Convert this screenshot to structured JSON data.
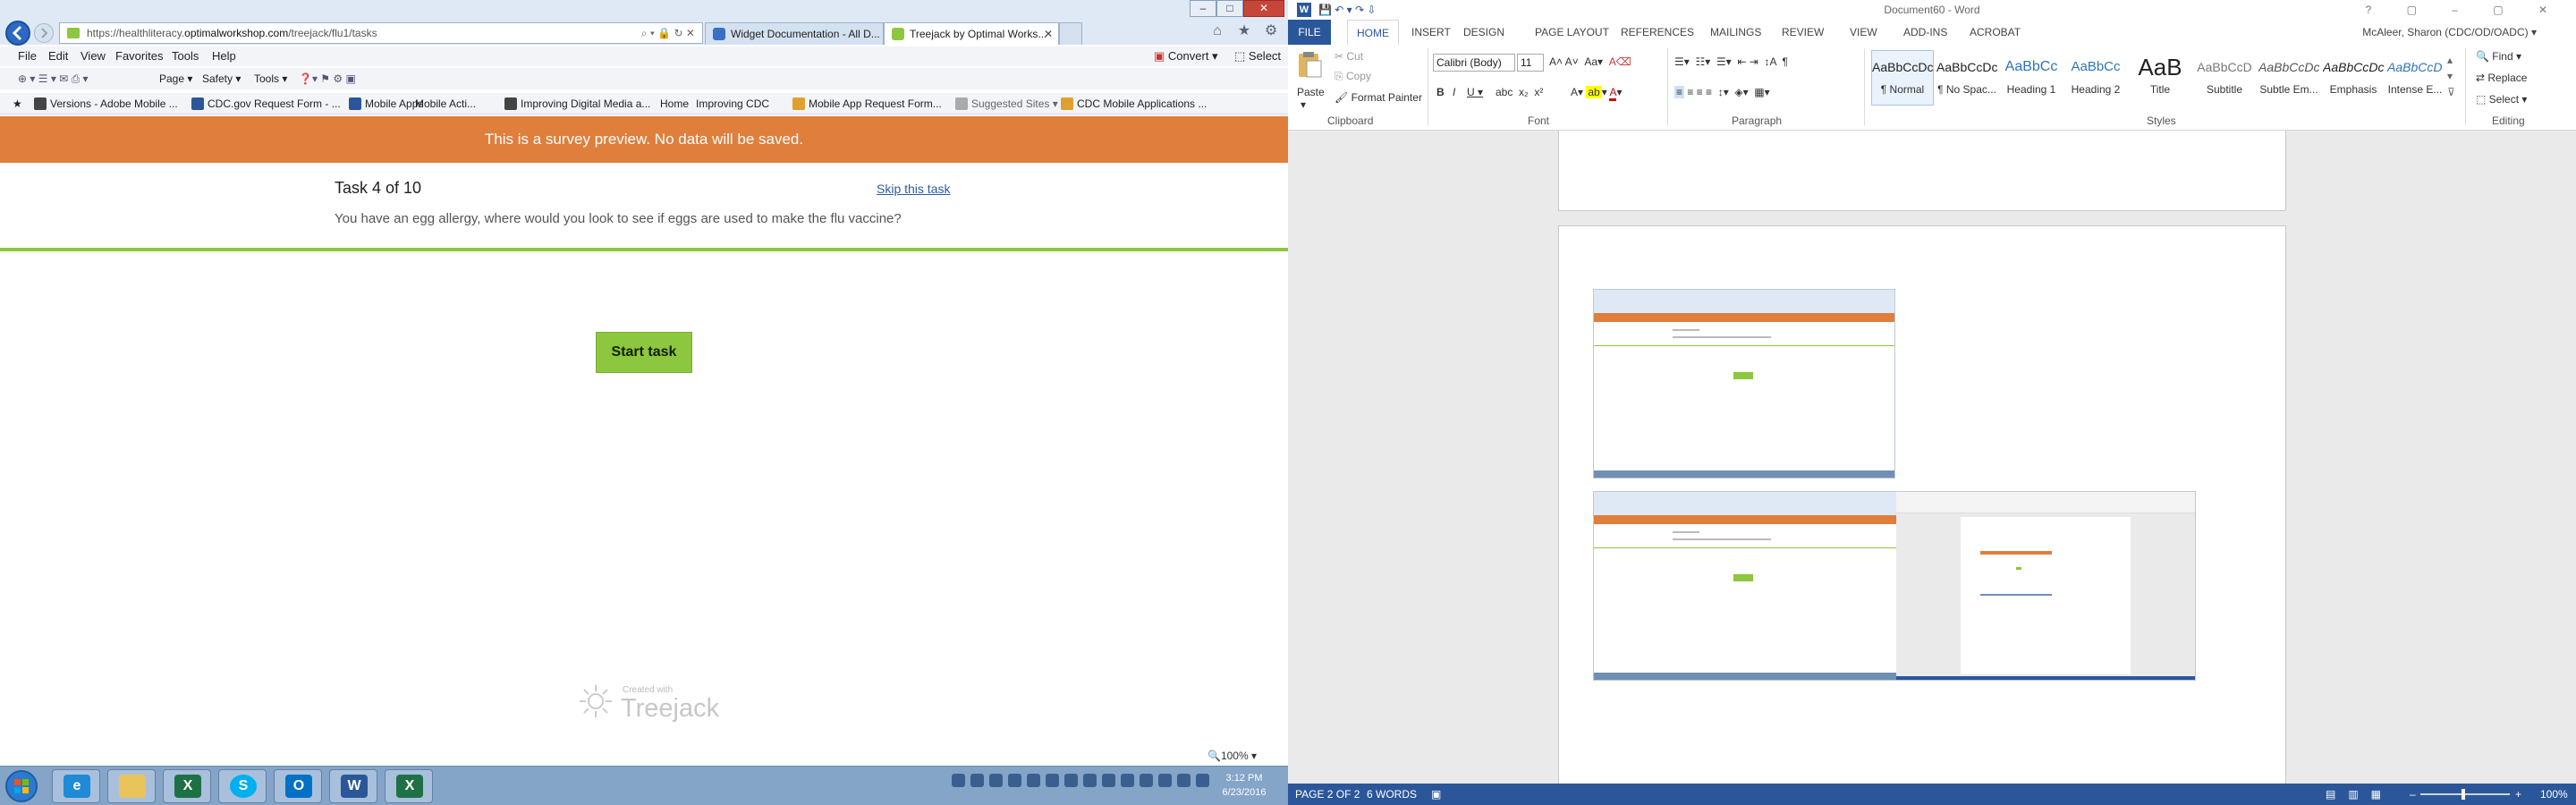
{
  "ie": {
    "address_prefix": "https://healthliteracy.",
    "address_domain": "optimalworkshop.com",
    "address_path": "/treejack/flu1/tasks",
    "tabs": [
      {
        "label": "Widget Documentation - All D...",
        "color": "#3a6fc4"
      },
      {
        "label": "Treejack by Optimal Works...",
        "color": "#8dc63f"
      }
    ],
    "menu": [
      "File",
      "Edit",
      "View",
      "Favorites",
      "Tools",
      "Help"
    ],
    "convert_label": "Convert",
    "select_label": "Select",
    "commands": [
      "Page",
      "Safety",
      "Tools"
    ],
    "favorites": [
      {
        "label": "Versions - Adobe Mobile ...",
        "color": "#444444"
      },
      {
        "label": "CDC.gov Request Form - ...",
        "color": "#2b579a"
      },
      {
        "label": "Mobile Apps",
        "color": "#2b579a"
      },
      {
        "label": "Mobile Acti...",
        "color": "#666666"
      },
      {
        "label": "Improving Digital Media a...",
        "color": "#444444"
      },
      {
        "label": "Home",
        "color": "#888888"
      },
      {
        "label": "Improving CDC",
        "color": "#888888"
      },
      {
        "label": "Mobile App Request Form...",
        "color": "#e0a030"
      },
      {
        "label": "Suggested Sites",
        "color": "#888888"
      },
      {
        "label": "CDC Mobile Applications ...",
        "color": "#e0a030"
      }
    ],
    "zoom": "100%"
  },
  "treejack": {
    "banner": "This is a survey preview. No data will be saved.",
    "task_counter": "Task 4 of 10",
    "skip": "Skip this task",
    "question": "You have an egg allergy, where would you look to see if eggs are used to make the flu vaccine?",
    "start": "Start task",
    "created_with": "Created with",
    "logo": "Treejack",
    "colors": {
      "banner": "#e07e3c",
      "accent": "#8dc63f"
    }
  },
  "word": {
    "title": "Document60 - Word",
    "user": "McAleer, Sharon (CDC/OD/OADC)",
    "tabs": [
      "FILE",
      "HOME",
      "INSERT",
      "DESIGN",
      "PAGE LAYOUT",
      "REFERENCES",
      "MAILINGS",
      "REVIEW",
      "VIEW",
      "ADD-INS",
      "ACROBAT"
    ],
    "clipboard": {
      "paste": "Paste",
      "cut": "Cut",
      "copy": "Copy",
      "format_painter": "Format Painter",
      "label": "Clipboard"
    },
    "font": {
      "name": "Calibri (Body)",
      "size": "11",
      "label": "Font"
    },
    "paragraph_label": "Paragraph",
    "styles_label": "Styles",
    "styles": [
      {
        "preview": "AaBbCcDc",
        "name": "¶ Normal"
      },
      {
        "preview": "AaBbCcDc",
        "name": "¶ No Spac..."
      },
      {
        "preview": "AaBbCc",
        "name": "Heading 1"
      },
      {
        "preview": "AaBbCc",
        "name": "Heading 2"
      },
      {
        "preview": "AaB",
        "name": "Title"
      },
      {
        "preview": "AaBbCcD",
        "name": "Subtitle"
      },
      {
        "preview": "AaBbCcDc",
        "name": "Subtle Em..."
      },
      {
        "preview": "AaBbCcDc",
        "name": "Emphasis"
      },
      {
        "preview": "AaBbCcDc",
        "name": "Intense E..."
      }
    ],
    "editing": {
      "find": "Find",
      "replace": "Replace",
      "select": "Select",
      "label": "Editing"
    },
    "status": {
      "page": "PAGE 2 OF 2",
      "words": "6 WORDS",
      "zoom": "100%"
    }
  },
  "taskbar": {
    "time": "3:12 PM",
    "date": "6/23/2016"
  }
}
